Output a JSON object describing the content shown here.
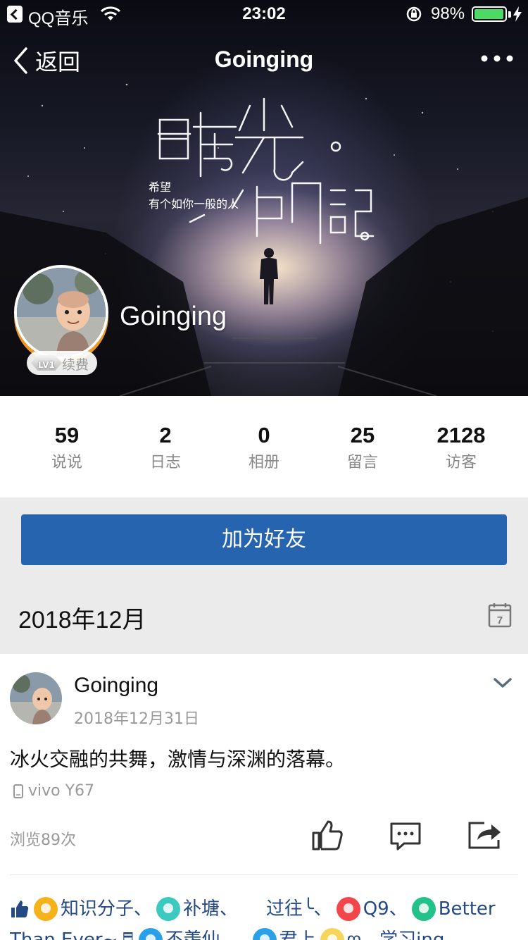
{
  "status_bar": {
    "app_name": "QQ音乐",
    "time": "23:02",
    "battery": "98%",
    "battery_level": 0.98
  },
  "nav": {
    "back_label": "返回",
    "title": "Goinging"
  },
  "cover": {
    "art_subtitle_line1": "希望",
    "art_subtitle_line2": "有个如你一般的人"
  },
  "profile": {
    "name": "Goinging",
    "level": "LV1",
    "renew_label": "续费"
  },
  "stats": [
    {
      "value": "59",
      "label": "说说"
    },
    {
      "value": "2",
      "label": "日志"
    },
    {
      "value": "0",
      "label": "相册"
    },
    {
      "value": "25",
      "label": "留言"
    },
    {
      "value": "2128",
      "label": "访客"
    }
  ],
  "add_friend_label": "加为好友",
  "month": {
    "title": "2018年12月",
    "calendar_day": "7"
  },
  "post": {
    "author": "Goinging",
    "date": "2018年12月31日",
    "text": "冰火交融的共舞，激情与深渊的落幕。",
    "device": "vivo Y67",
    "views": "浏览89次"
  },
  "likers": [
    {
      "name": "知识分子、",
      "color": "#f5b21b"
    },
    {
      "name": "补塘、",
      "color": "#3cc9c0"
    },
    {
      "name": "过往╰、",
      "color": "#ffffff"
    },
    {
      "name": "Q9、",
      "color": "#f2464b"
    },
    {
      "name": "Better Than Ever~♬",
      "color": "#23c28a"
    },
    {
      "name": "不羡仙",
      "color": "#2aa0e8"
    },
    {
      "name": "君上",
      "color": "#2aa0e8"
    },
    {
      "name": "ღ、学习ing",
      "color": "#f5d55a"
    }
  ],
  "colors": {
    "accent_blue": "#2764b0",
    "link_blue": "#244a85",
    "avatar_ring": "#f39a1e"
  }
}
